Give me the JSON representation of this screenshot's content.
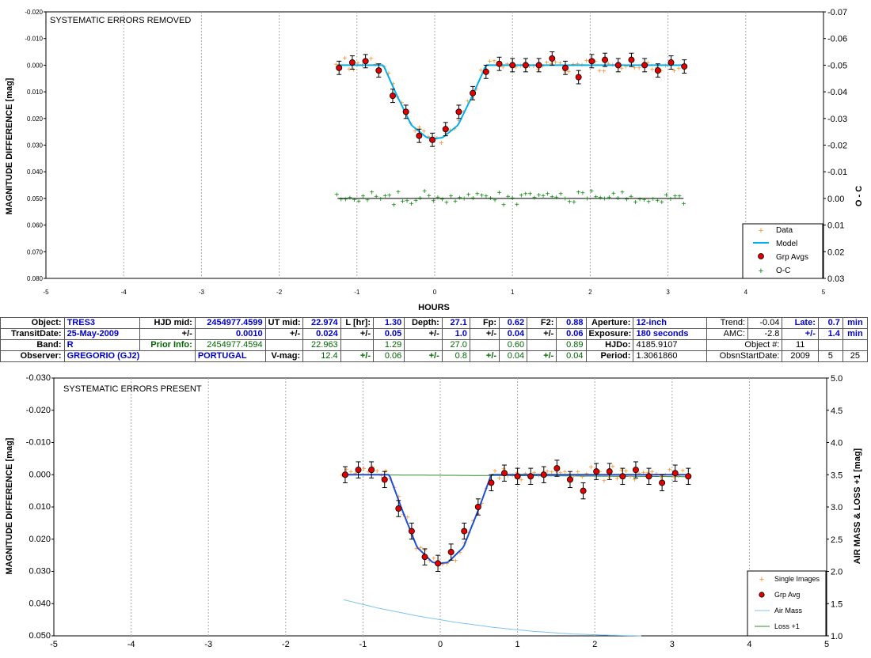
{
  "top_chart": {
    "title": "SYSTEMATIC ERRORS REMOVED",
    "ylabel": "MAGNITUDE DIFFERENCE [mag]",
    "ylabel_right": "O - C",
    "xlabel": "HOURS",
    "legend": [
      "Data",
      "Model",
      "Grp Avgs",
      "O-C"
    ],
    "colors": {
      "data": "#ff8c1a",
      "model": "#00b0f0",
      "grp": "#e00000",
      "oc": "#008000"
    }
  },
  "bottom_chart": {
    "title": "SYSTEMATIC ERRORS PRESENT",
    "ylabel": "MAGNITUDE DIFFERENCE [mag]",
    "ylabel_right": "AIR MASS & LOSS +1 [mag]",
    "legend": [
      "Single Images",
      "Grp Avg",
      "Air Mass",
      "Loss +1"
    ],
    "colors": {
      "data": "#ff8c1a",
      "model": "#1f4fd8",
      "grp": "#e00000",
      "airmass": "#7cc4f0",
      "loss": "#2e8b2e"
    }
  },
  "info_table": {
    "row1": {
      "object_label": "Object:",
      "object": "TRES3",
      "hjd_label": "HJD mid:",
      "hjd": "2454977.4599",
      "ut_label": "UT mid:",
      "ut": "22.974",
      "l_label": "L [hr]:",
      "l": "1.30",
      "depth_label": "Depth:",
      "depth": "27.1",
      "fp_label": "Fp:",
      "fp": "0.62",
      "f2_label": "F2:",
      "f2": "0.88",
      "aperture_label": "Aperture:",
      "aperture": "12-inch",
      "trend_label": "Trend:",
      "trend": "-0.04",
      "late_label": "Late:",
      "late": "0.7",
      "late_unit": "min"
    },
    "row2": {
      "transit_label": "TransitDate:",
      "transit": "25-May-2009",
      "pm": "+/-",
      "hjd_err": "0.0010",
      "ut_err": "0.024",
      "l_err": "0.05",
      "depth_err": "1.0",
      "fp_err": "0.04",
      "f2_err": "0.06",
      "exposure_label": "Exposure:",
      "exposure": "180 seconds",
      "amc_label": "AMC:",
      "amc": "-2.8",
      "late_err": "1.4",
      "late_unit": "min"
    },
    "row3": {
      "band_label": "Band:",
      "band": "R",
      "prior_label": "Prior Info:",
      "prior_hjd": "2454977.4594",
      "ut": "22.963",
      "l": "1.29",
      "depth": "27.0",
      "fp": "0.60",
      "f2": "0.89",
      "hjdo_label": "HJDo:",
      "hjdo": "4185.9107",
      "objnum_label": "Object #:",
      "objnum": "11"
    },
    "row4": {
      "observer_label": "Observer:",
      "observer": "GREGORIO (GJ2)",
      "country": "PORTUGAL",
      "vmag_label": "V-mag:",
      "vmag": "12.4",
      "l_err": "0.06",
      "depth_err": "0.8",
      "fp_err": "0.04",
      "f2_err": "0.04",
      "period_label": "Period:",
      "period": "1.3061860",
      "start_label": "ObsnStartDate:",
      "year": "2009",
      "month": "5",
      "day": "25"
    }
  },
  "chart_data": [
    {
      "type": "scatter",
      "title": "SYSTEMATIC ERRORS REMOVED",
      "xlabel": "HOURS",
      "ylabel": "MAGNITUDE DIFFERENCE [mag]",
      "y2label": "O - C",
      "xlim": [
        -5,
        5
      ],
      "xticks": [
        -5,
        -4,
        -3,
        -2,
        -1,
        0,
        1,
        2,
        3,
        4,
        5
      ],
      "ylim": [
        0.08,
        -0.02
      ],
      "yticks": [
        "-0.020",
        "-0.010",
        "0.000",
        "0.010",
        "0.020",
        "0.030",
        "0.040",
        "0.050",
        "0.060",
        "0.070",
        "0.080"
      ],
      "y2lim": [
        0.03,
        -0.07
      ],
      "y2ticks": [
        "-0.07",
        "-0.06",
        "-0.05",
        "-0.04",
        "-0.03",
        "-0.02",
        "-0.01",
        "0.00",
        "0.01",
        "0.02",
        "0.03"
      ],
      "grid": "x-dotted",
      "legend_position": "bottom-right",
      "series": [
        {
          "name": "Grp Avgs",
          "x": [
            -1.23,
            -1.06,
            -0.89,
            -0.72,
            -0.54,
            -0.37,
            -0.2,
            -0.03,
            0.14,
            0.31,
            0.49,
            0.66,
            0.83,
            1.0,
            1.17,
            1.34,
            1.51,
            1.68,
            1.85,
            2.02,
            2.19,
            2.36,
            2.53,
            2.7,
            2.87,
            3.04,
            3.21
          ],
          "y": [
            0.001,
            -0.001,
            -0.0015,
            0.002,
            0.0115,
            0.0175,
            0.0265,
            0.028,
            0.024,
            0.0175,
            0.0105,
            0.0025,
            -0.0005,
            0.0,
            0.0,
            0.0,
            -0.0025,
            0.001,
            0.0045,
            -0.0015,
            -0.002,
            0.0,
            -0.002,
            0.0,
            0.002,
            -0.001,
            0.0005
          ],
          "err": 0.0025
        },
        {
          "name": "Model",
          "x": [
            -1.25,
            -0.66,
            -0.5,
            -0.3,
            -0.1,
            0.0,
            0.1,
            0.3,
            0.5,
            0.66,
            3.2
          ],
          "y": [
            0.0,
            0.0,
            0.0105,
            0.0225,
            0.0272,
            0.0275,
            0.0272,
            0.0225,
            0.0105,
            0.0,
            0.0
          ]
        },
        {
          "name": "Data",
          "scatter_sigma": 0.0022
        },
        {
          "name": "O-C",
          "center": 0.0,
          "scatter_sigma": 0.0022
        }
      ]
    },
    {
      "type": "scatter",
      "title": "SYSTEMATIC ERRORS PRESENT",
      "ylabel": "MAGNITUDE DIFFERENCE [mag]",
      "y2label": "AIR MASS & LOSS +1 [mag]",
      "xlim": [
        -5,
        5
      ],
      "xticks": [
        -5,
        -4,
        -3,
        -2,
        -1,
        0,
        1,
        2,
        3,
        4,
        5
      ],
      "ylim": [
        0.05,
        -0.03
      ],
      "yticks": [
        "-0.030",
        "-0.020",
        "-0.010",
        "0.000",
        "0.010",
        "0.020",
        "0.030",
        "0.040",
        "0.050"
      ],
      "y2lim": [
        1.0,
        5.0
      ],
      "y2ticks": [
        "5.0",
        "4.5",
        "4.0",
        "3.5",
        "3.0",
        "2.5",
        "2.0",
        "1.5",
        "1.0"
      ],
      "grid": "x-dotted",
      "legend_position": "bottom-right",
      "series": [
        {
          "name": "Grp Avg",
          "x": [
            -1.23,
            -1.06,
            -0.89,
            -0.72,
            -0.54,
            -0.37,
            -0.2,
            -0.03,
            0.14,
            0.31,
            0.49,
            0.66,
            0.83,
            1.0,
            1.17,
            1.34,
            1.51,
            1.68,
            1.85,
            2.02,
            2.19,
            2.36,
            2.53,
            2.7,
            2.87,
            3.04,
            3.21
          ],
          "y": [
            0.0,
            -0.0015,
            -0.0015,
            0.0015,
            0.0105,
            0.0175,
            0.0255,
            0.0275,
            0.024,
            0.0175,
            0.01,
            0.0025,
            -0.0005,
            0.0005,
            0.0005,
            0.0,
            -0.002,
            0.0015,
            0.005,
            -0.001,
            -0.001,
            0.0005,
            -0.0015,
            0.0005,
            0.0025,
            -0.0005,
            0.0005
          ],
          "err": 0.0025
        },
        {
          "name": "Model",
          "x": [
            -1.25,
            -0.66,
            -0.5,
            -0.3,
            -0.1,
            0.0,
            0.1,
            0.3,
            0.5,
            0.66,
            3.2
          ],
          "y": [
            0.0,
            0.0,
            0.0105,
            0.0225,
            0.0272,
            0.0275,
            0.0272,
            0.0225,
            0.0105,
            0.0,
            0.0
          ]
        },
        {
          "name": "Loss +1",
          "x": [
            -1.25,
            3.2
          ],
          "y2": [
            3.5,
            3.47
          ]
        },
        {
          "name": "Air Mass",
          "x": [
            -1.25,
            -0.8,
            -0.3,
            0.2,
            0.7,
            1.2,
            1.7,
            2.2,
            2.6
          ],
          "y2": [
            1.56,
            1.43,
            1.31,
            1.21,
            1.13,
            1.07,
            1.03,
            1.01,
            1.0
          ]
        },
        {
          "name": "Single Images",
          "scatter_sigma": 0.0022
        }
      ]
    }
  ]
}
